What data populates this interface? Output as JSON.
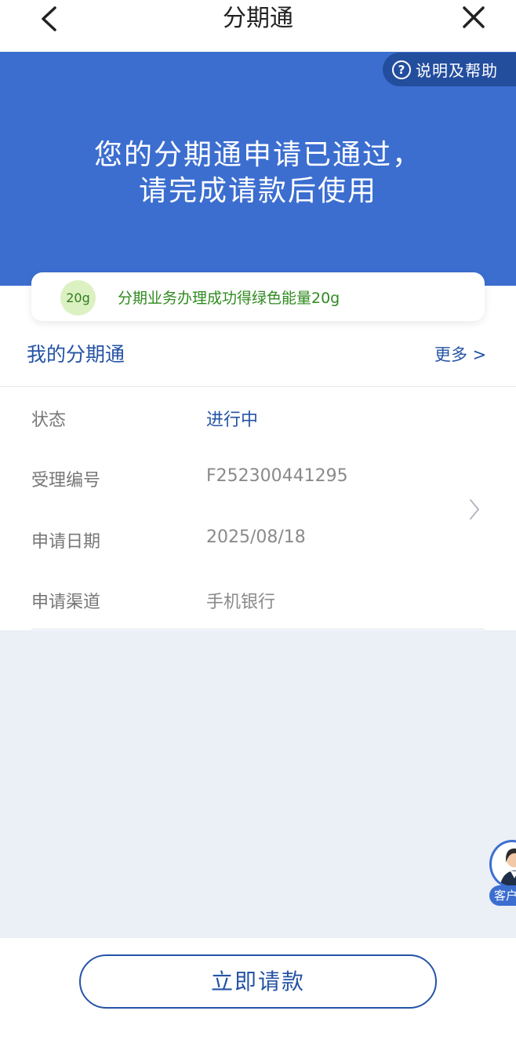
{
  "nav": {
    "title": "分期通",
    "back_icon": "chevron-left-icon",
    "close_icon": "close-icon"
  },
  "banner": {
    "help_label": "说明及帮助",
    "line1": "您的分期通申请已通过，",
    "line2": "请完成请款后使用",
    "color": "#3c6ed0"
  },
  "energy": {
    "badge": "20g",
    "text": "分期业务办理成功得绿色能量20g"
  },
  "section": {
    "title": "我的分期通",
    "more": "更多 >"
  },
  "details": [
    {
      "label": "状态",
      "value": "进行中"
    },
    {
      "label": "受理编号",
      "value": "F252300441295"
    },
    {
      "label": "申请日期",
      "value": "2025/08/18"
    },
    {
      "label": "申请渠道",
      "value": "手机银行"
    }
  ],
  "service": {
    "label": "客户"
  },
  "footer": {
    "cta_label": "立即请款"
  },
  "colors": {
    "accent": "#2553a6",
    "banner": "#3c6ed0",
    "green": "#2f8a1f"
  }
}
